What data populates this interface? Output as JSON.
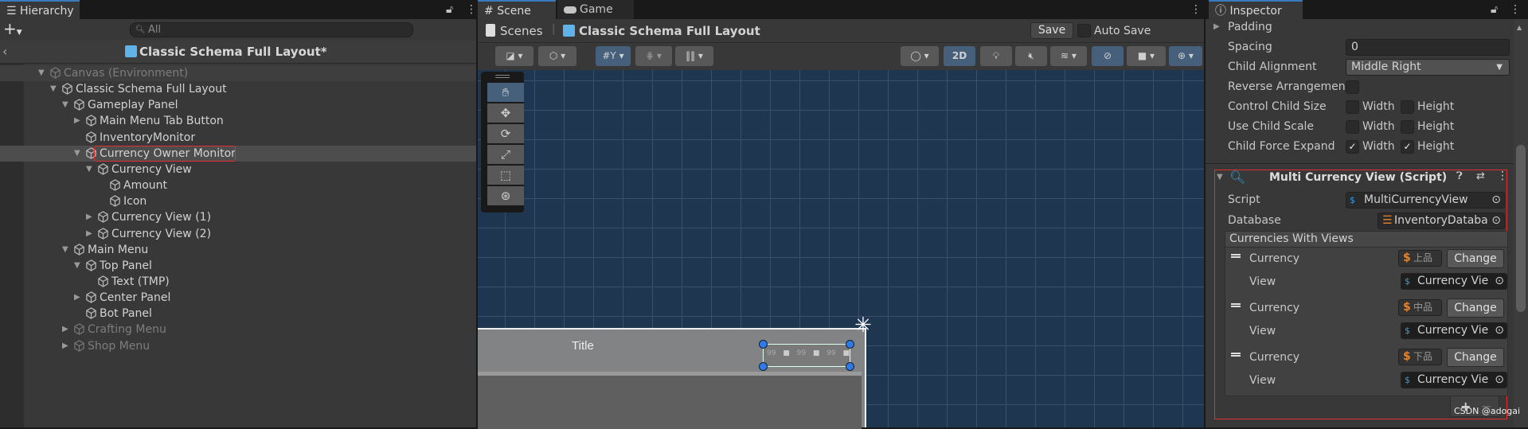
{
  "hierarchy": {
    "tab": "Hierarchy",
    "search_placeholder": "All",
    "prefab_title": "Classic Schema Full Layout*",
    "items": [
      {
        "label": "Canvas (Environment)",
        "depth": 0,
        "expander": "open",
        "dimmed": true
      },
      {
        "label": "Classic Schema Full Layout",
        "depth": 1,
        "expander": "open"
      },
      {
        "label": "Gameplay Panel",
        "depth": 2,
        "expander": "open"
      },
      {
        "label": "Main Menu Tab Button",
        "depth": 3,
        "expander": "closed"
      },
      {
        "label": "InventoryMonitor",
        "depth": 3,
        "expander": "none"
      },
      {
        "label": "Currency Owner Monitor",
        "depth": 3,
        "expander": "open",
        "selected": true
      },
      {
        "label": "Currency View",
        "depth": 4,
        "expander": "open"
      },
      {
        "label": "Amount",
        "depth": 5,
        "expander": "none"
      },
      {
        "label": "Icon",
        "depth": 5,
        "expander": "none"
      },
      {
        "label": "Currency View (1)",
        "depth": 4,
        "expander": "closed"
      },
      {
        "label": "Currency View (2)",
        "depth": 4,
        "expander": "closed"
      },
      {
        "label": "Main Menu",
        "depth": 2,
        "expander": "open"
      },
      {
        "label": "Top Panel",
        "depth": 3,
        "expander": "open"
      },
      {
        "label": "Text (TMP)",
        "depth": 4,
        "expander": "none"
      },
      {
        "label": "Center Panel",
        "depth": 3,
        "expander": "closed"
      },
      {
        "label": "Bot Panel",
        "depth": 3,
        "expander": "none"
      },
      {
        "label": "Crafting Menu",
        "depth": 2,
        "expander": "closed",
        "dimmed": true
      },
      {
        "label": "Shop Menu",
        "depth": 2,
        "expander": "closed",
        "dimmed": true
      }
    ]
  },
  "scene": {
    "tabs": [
      "Scene",
      "Game"
    ],
    "breadcrumb_root": "Scenes",
    "breadcrumb_current": "Classic Schema Full Layout",
    "save_label": "Save",
    "auto_save_label": "Auto Save",
    "mode_2d": "2D",
    "canvas_title": "Title",
    "amounts": [
      "99",
      "99",
      "99"
    ]
  },
  "inspector": {
    "tab": "Inspector",
    "padding": "Padding",
    "spacing_label": "Spacing",
    "spacing_value": "0",
    "alignment_label": "Child Alignment",
    "alignment_value": "Middle Right",
    "reverse_label": "Reverse Arrangemen",
    "control_label": "Control Child Size",
    "scale_label": "Use Child Scale",
    "expand_label": "Child Force Expand",
    "width": "Width",
    "height": "Height",
    "control": {
      "width": false,
      "height": false
    },
    "scale": {
      "width": false,
      "height": false
    },
    "expand": {
      "width": true,
      "height": true
    },
    "component_title": "Multi Currency View (Script)",
    "script_label": "Script",
    "script_value": "MultiCurrencyView",
    "database_label": "Database",
    "database_value": "InventoryDataba",
    "list_title": "Currencies With Views",
    "entries": [
      {
        "currency_label": "Currency",
        "currency_value": "上品",
        "change": "Change",
        "view_label": "View",
        "view_value": "Currency Vie"
      },
      {
        "currency_label": "Currency",
        "currency_value": "中品",
        "change": "Change",
        "view_label": "View",
        "view_value": "Currency Vie"
      },
      {
        "currency_label": "Currency",
        "currency_value": "下品",
        "change": "Change",
        "view_label": "View",
        "view_value": "Currency Vie"
      }
    ],
    "add": "+",
    "remove": "−"
  },
  "watermark": "CSDN @adogai",
  "colors": {
    "accent": "#3a79bb",
    "selection_outline": "#e03030",
    "scene_bg": "#1f3650",
    "currency": "#e8832a"
  }
}
